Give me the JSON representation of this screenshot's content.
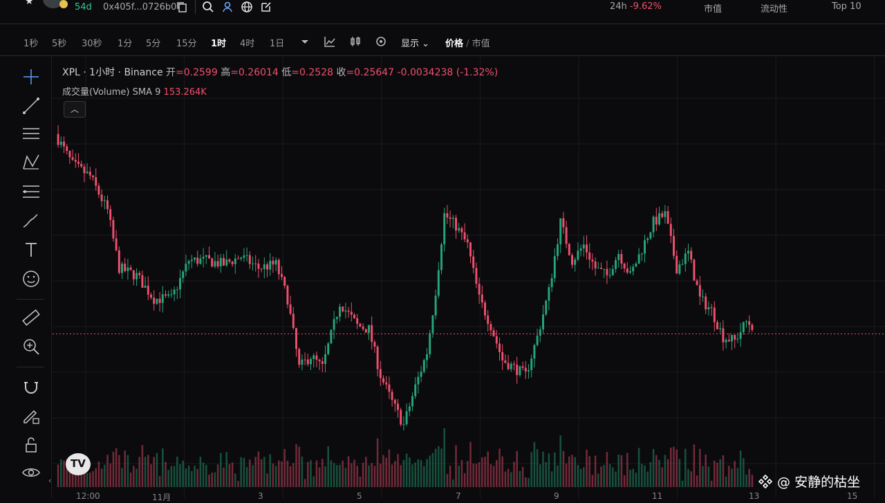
{
  "header": {
    "age": "54d",
    "address": "0x405f...0726b0",
    "change_label": "24h",
    "change_value": "-9.62%",
    "stats": [
      "市值",
      "流动性",
      "Top 10"
    ]
  },
  "toolbar": {
    "timeframes": [
      "1秒",
      "5秒",
      "30秒",
      "1分",
      "5分",
      "15分",
      "1时",
      "4时",
      "1日"
    ],
    "active_timeframe": "1时",
    "display_label": "显示",
    "price_label": "价格",
    "mcap_label": "市值"
  },
  "legend": {
    "title": "XPL · 1小时 · Binance",
    "open_label": "开",
    "open": "=0.2599",
    "high_label": "高",
    "high": "=0.26014",
    "low_label": "低",
    "low": "=0.2528",
    "close_label": "收",
    "close": "=0.25647",
    "change": "-0.0034238 (-1.32%)",
    "volume_label": "成交量(Volume) SMA 9",
    "volume_value": "153.264K"
  },
  "x_axis": [
    "12:00",
    "11月",
    "3",
    "5",
    "7",
    "9",
    "11",
    "13",
    "15"
  ],
  "watermark": "@ 安静的枯坐",
  "colors": {
    "up": "#26a67a",
    "down": "#f0506e",
    "grid": "#1b1b1f",
    "bg": "#0b0b0d"
  },
  "chart_data": {
    "type": "candlestick",
    "keypoints": [
      [
        0,
        0.305
      ],
      [
        6,
        0.297
      ],
      [
        12,
        0.294
      ],
      [
        18,
        0.285
      ],
      [
        22,
        0.27
      ],
      [
        28,
        0.268
      ],
      [
        34,
        0.262
      ],
      [
        40,
        0.262
      ],
      [
        46,
        0.272
      ],
      [
        52,
        0.272
      ],
      [
        58,
        0.271
      ],
      [
        64,
        0.273
      ],
      [
        70,
        0.27
      ],
      [
        76,
        0.271
      ],
      [
        80,
        0.262
      ],
      [
        84,
        0.244
      ],
      [
        88,
        0.247
      ],
      [
        92,
        0.244
      ],
      [
        98,
        0.261
      ],
      [
        104,
        0.255
      ],
      [
        108,
        0.254
      ],
      [
        112,
        0.242
      ],
      [
        116,
        0.235
      ],
      [
        120,
        0.229
      ],
      [
        124,
        0.239
      ],
      [
        128,
        0.248
      ],
      [
        131,
        0.264
      ],
      [
        134,
        0.284
      ],
      [
        138,
        0.281
      ],
      [
        142,
        0.276
      ],
      [
        146,
        0.262
      ],
      [
        150,
        0.255
      ],
      [
        154,
        0.246
      ],
      [
        158,
        0.244
      ],
      [
        162,
        0.242
      ],
      [
        166,
        0.252
      ],
      [
        170,
        0.264
      ],
      [
        174,
        0.282
      ],
      [
        178,
        0.272
      ],
      [
        182,
        0.276
      ],
      [
        186,
        0.27
      ],
      [
        190,
        0.268
      ],
      [
        194,
        0.274
      ],
      [
        198,
        0.268
      ],
      [
        202,
        0.275
      ],
      [
        206,
        0.282
      ],
      [
        210,
        0.284
      ],
      [
        214,
        0.27
      ],
      [
        218,
        0.274
      ],
      [
        222,
        0.262
      ],
      [
        226,
        0.259
      ],
      [
        230,
        0.252
      ],
      [
        234,
        0.251
      ],
      [
        238,
        0.256
      ],
      [
        240,
        0.255
      ]
    ],
    "current_price": 0.2528,
    "y_range": [
      0.224,
      0.314
    ]
  }
}
